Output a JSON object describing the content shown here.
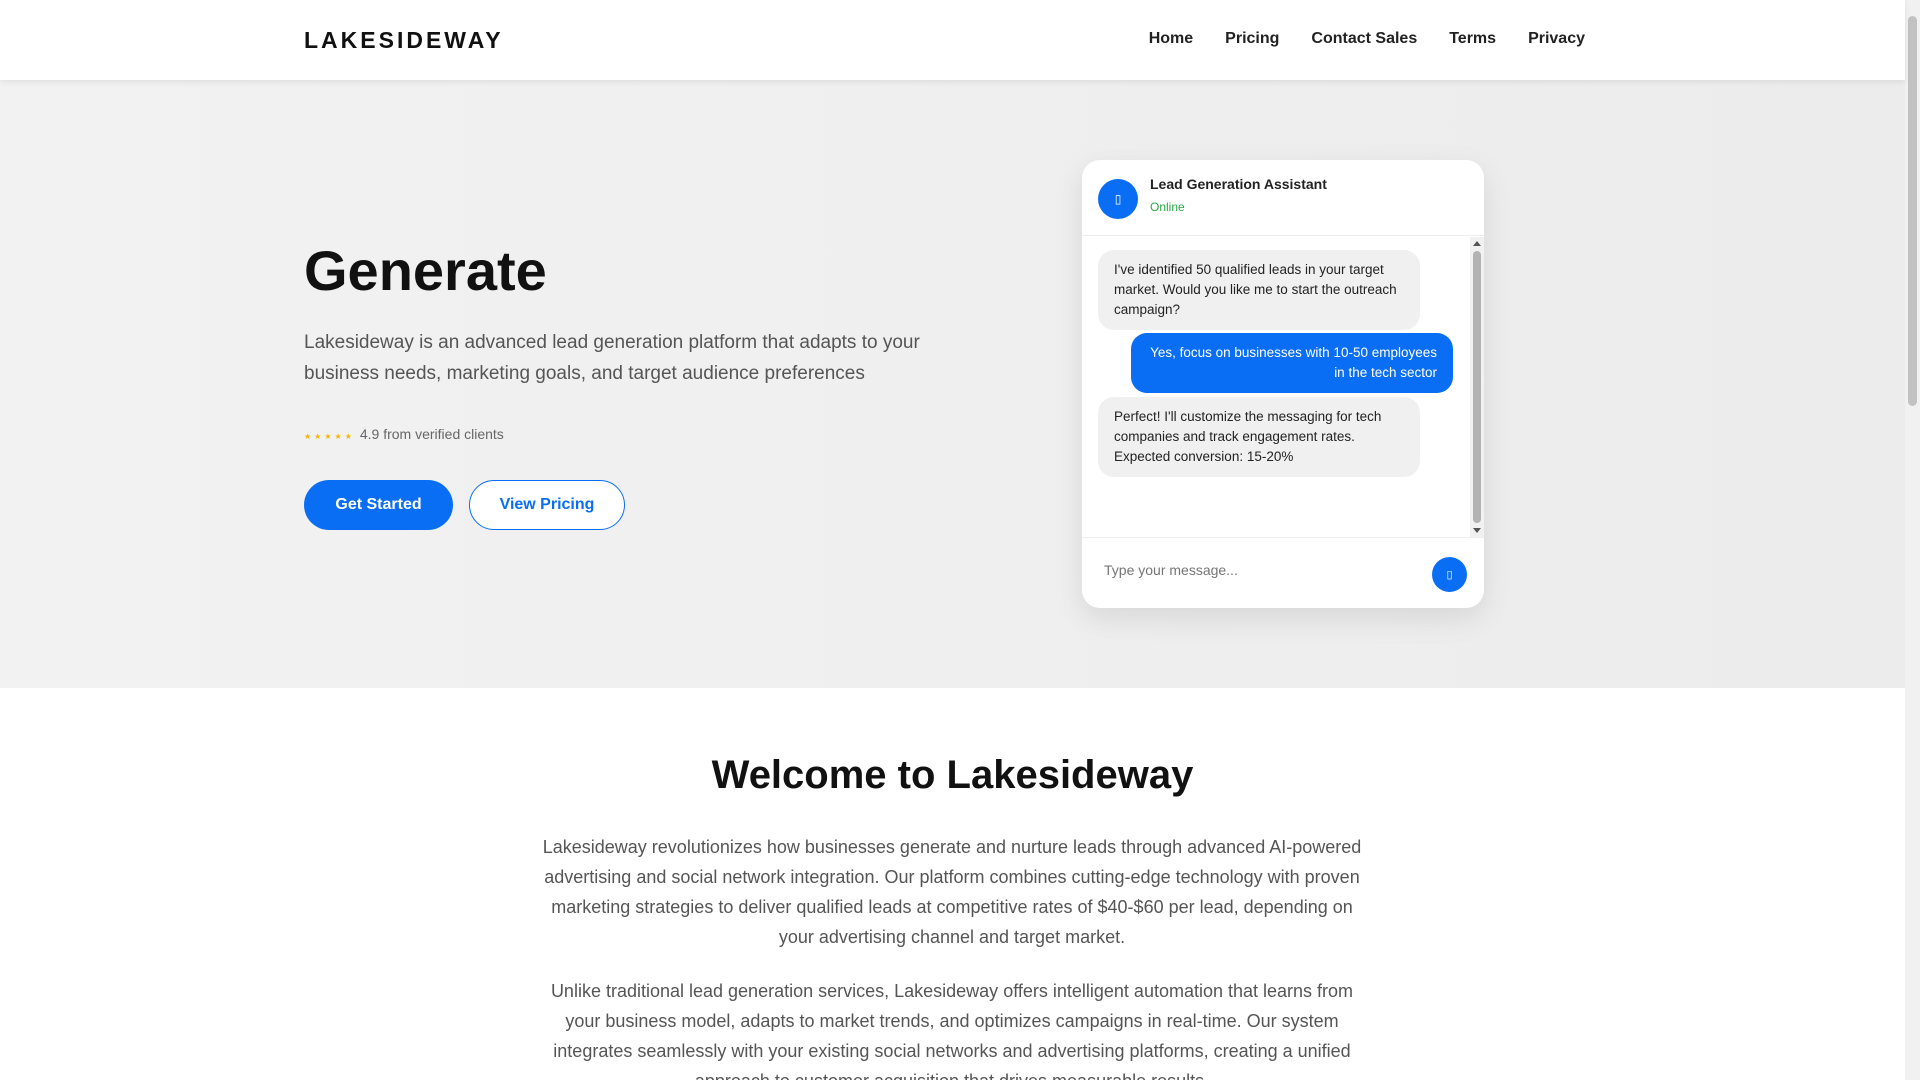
{
  "header": {
    "logo": "LAKESIDEWAY",
    "nav": [
      "Home",
      "Pricing",
      "Contact Sales",
      "Terms",
      "Privacy"
    ]
  },
  "hero": {
    "title": "Generate",
    "subtitle": "Lakesideway is an advanced lead generation platform that adapts to your business needs, marketing goals, and target audience preferences",
    "rating_text": "4.9 from verified clients",
    "rating_value": 4.9,
    "primary_button": "Get Started",
    "secondary_button": "View Pricing"
  },
  "chat": {
    "assistant_name": "Lead Generation Assistant",
    "status": "Online",
    "messages": [
      {
        "from": "bot",
        "text": "I've identified 50 qualified leads in your target market. Would you like me to start the outreach campaign?"
      },
      {
        "from": "user",
        "text": "Yes, focus on businesses with 10-50 employees in the tech sector"
      },
      {
        "from": "bot",
        "text": "Perfect! I'll customize the messaging for tech companies and track engagement rates. Expected conversion: 15-20%"
      }
    ],
    "input_placeholder": "Type your message..."
  },
  "welcome": {
    "title": "Welcome to Lakesideway",
    "paragraph1": "Lakesideway revolutionizes how businesses generate and nurture leads through advanced AI-powered advertising and social network integration. Our platform combines cutting-edge technology with proven marketing strategies to deliver qualified leads at competitive rates of $40-$60 per lead, depending on your advertising channel and target market.",
    "paragraph2": "Unlike traditional lead generation services, Lakesideway offers intelligent automation that learns from your business model, adapts to market trends, and optimizes campaigns in real-time. Our system integrates seamlessly with your existing social networks and advertising platforms, creating a unified approach to customer acquisition that drives measurable results."
  },
  "colors": {
    "accent": "#0a6ef5",
    "online": "#28a745",
    "star": "#f2b705"
  }
}
